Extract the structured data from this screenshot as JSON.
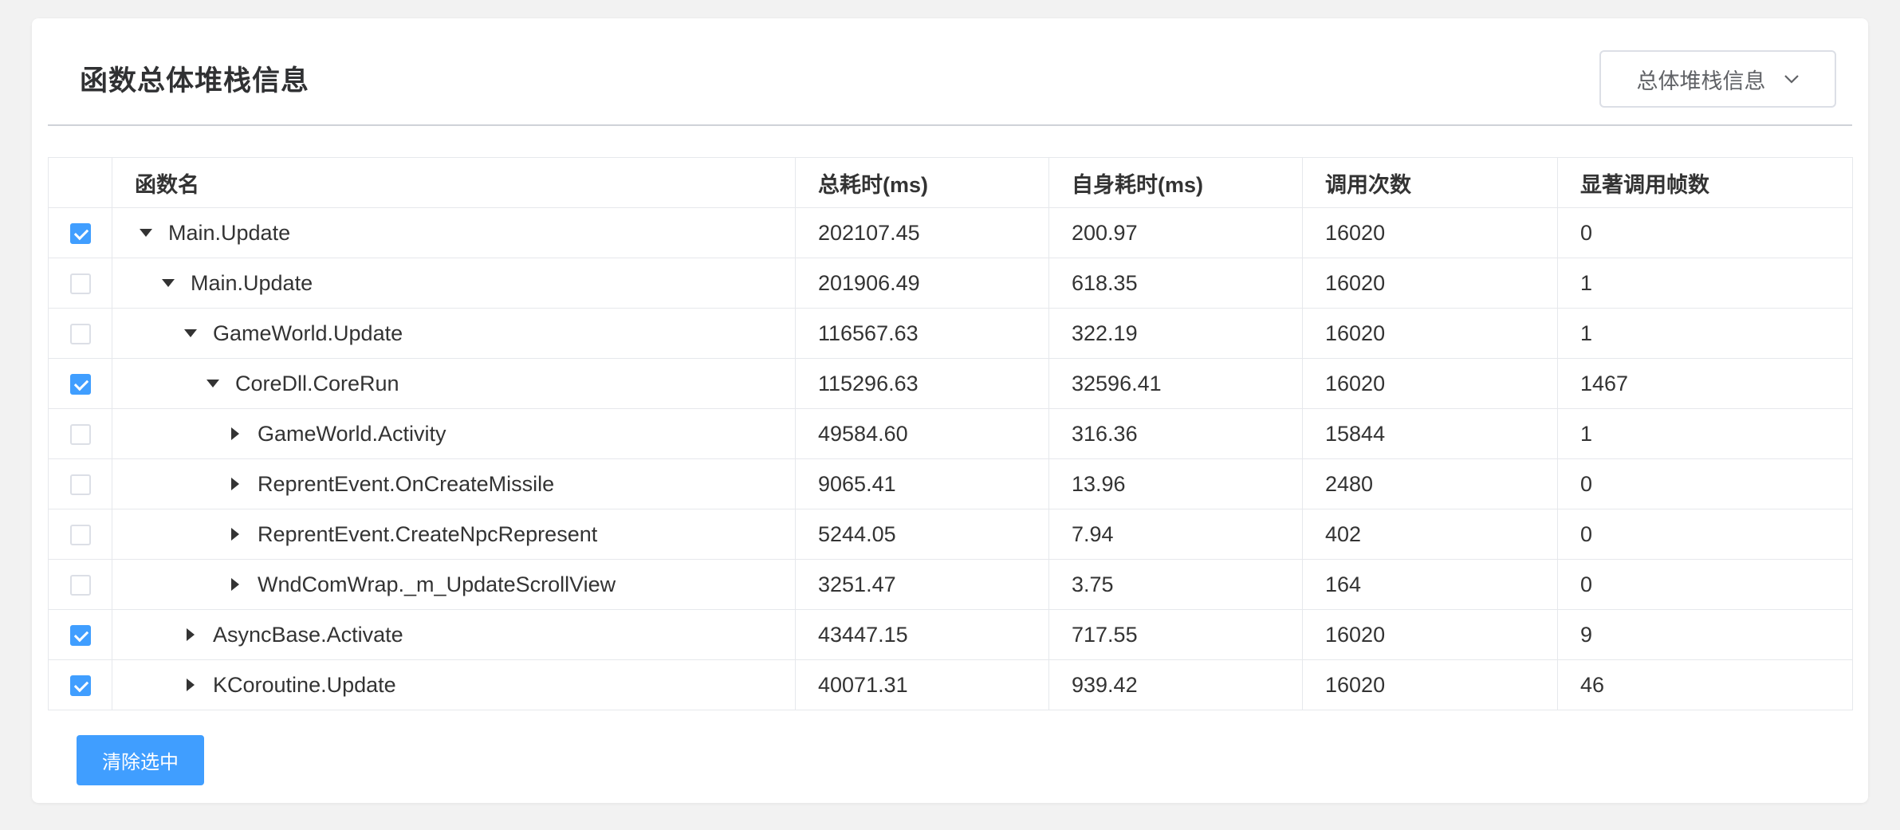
{
  "page": {
    "title": "函数总体堆栈信息",
    "dropdown": {
      "selected": "总体堆栈信息",
      "icon": "chevron-down-icon"
    }
  },
  "table": {
    "columns": [
      "函数名",
      "总耗时(ms)",
      "自身耗时(ms)",
      "调用次数",
      "显著调用帧数"
    ],
    "rows": [
      {
        "checked": true,
        "level": 0,
        "expanded": true,
        "name": "Main.Update",
        "total": "202107.45",
        "self": "200.97",
        "calls": "16020",
        "frames": "0"
      },
      {
        "checked": false,
        "level": 1,
        "expanded": true,
        "name": "Main.Update",
        "total": "201906.49",
        "self": "618.35",
        "calls": "16020",
        "frames": "1"
      },
      {
        "checked": false,
        "level": 2,
        "expanded": true,
        "name": "GameWorld.Update",
        "total": "116567.63",
        "self": "322.19",
        "calls": "16020",
        "frames": "1"
      },
      {
        "checked": true,
        "level": 3,
        "expanded": true,
        "name": "CoreDll.CoreRun",
        "total": "115296.63",
        "self": "32596.41",
        "calls": "16020",
        "frames": "1467"
      },
      {
        "checked": false,
        "level": 4,
        "expanded": false,
        "name": "GameWorld.Activity",
        "total": "49584.60",
        "self": "316.36",
        "calls": "15844",
        "frames": "1"
      },
      {
        "checked": false,
        "level": 4,
        "expanded": false,
        "name": "ReprentEvent.OnCreateMissile",
        "total": "9065.41",
        "self": "13.96",
        "calls": "2480",
        "frames": "0"
      },
      {
        "checked": false,
        "level": 4,
        "expanded": false,
        "name": "ReprentEvent.CreateNpcRepresent",
        "total": "5244.05",
        "self": "7.94",
        "calls": "402",
        "frames": "0"
      },
      {
        "checked": false,
        "level": 4,
        "expanded": false,
        "name": "WndComWrap._m_UpdateScrollView",
        "total": "3251.47",
        "self": "3.75",
        "calls": "164",
        "frames": "0"
      },
      {
        "checked": true,
        "level": 2,
        "expanded": false,
        "name": "AsyncBase.Activate",
        "total": "43447.15",
        "self": "717.55",
        "calls": "16020",
        "frames": "9"
      },
      {
        "checked": true,
        "level": 2,
        "expanded": false,
        "name": "KCoroutine.Update",
        "total": "40071.31",
        "self": "939.42",
        "calls": "16020",
        "frames": "46"
      }
    ]
  },
  "actions": {
    "clear_label": "清除选中"
  },
  "colors": {
    "primary": "#409eff",
    "background": "#f2f2f2"
  }
}
